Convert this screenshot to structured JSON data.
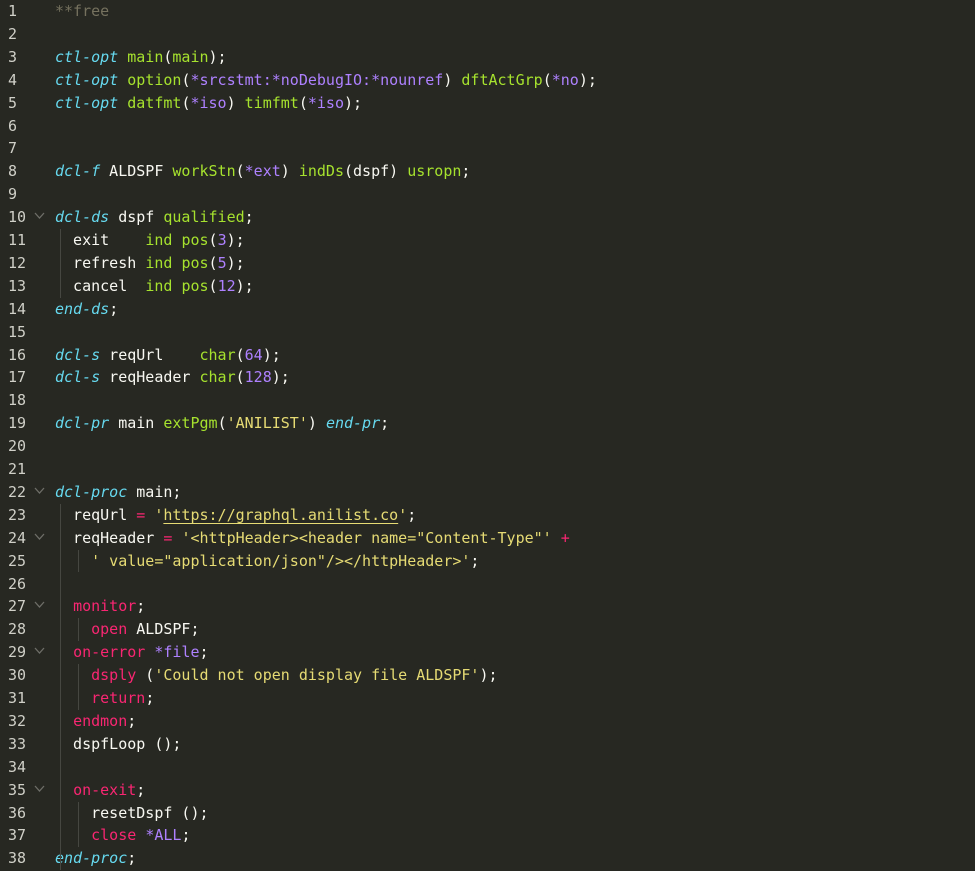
{
  "editor": {
    "lines": [
      {
        "n": "1",
        "fold": false,
        "tokens": [
          {
            "c": "c",
            "t": "**free"
          }
        ]
      },
      {
        "n": "2",
        "fold": false,
        "tokens": []
      },
      {
        "n": "3",
        "fold": false,
        "tokens": [
          {
            "c": "k",
            "t": "ctl-opt"
          },
          {
            "c": "t",
            "t": " "
          },
          {
            "c": "f",
            "t": "main"
          },
          {
            "c": "t",
            "t": "("
          },
          {
            "c": "f",
            "t": "main"
          },
          {
            "c": "t",
            "t": ");"
          }
        ]
      },
      {
        "n": "4",
        "fold": false,
        "tokens": [
          {
            "c": "k",
            "t": "ctl-opt"
          },
          {
            "c": "t",
            "t": " "
          },
          {
            "c": "f",
            "t": "option"
          },
          {
            "c": "t",
            "t": "("
          },
          {
            "c": "a",
            "t": "*srcstmt:*noDebugIO:*nounref"
          },
          {
            "c": "t",
            "t": ") "
          },
          {
            "c": "f",
            "t": "dftActGrp"
          },
          {
            "c": "t",
            "t": "("
          },
          {
            "c": "a",
            "t": "*no"
          },
          {
            "c": "t",
            "t": ");"
          }
        ]
      },
      {
        "n": "5",
        "fold": false,
        "tokens": [
          {
            "c": "k",
            "t": "ctl-opt"
          },
          {
            "c": "t",
            "t": " "
          },
          {
            "c": "f",
            "t": "datfmt"
          },
          {
            "c": "t",
            "t": "("
          },
          {
            "c": "a",
            "t": "*iso"
          },
          {
            "c": "t",
            "t": ") "
          },
          {
            "c": "f",
            "t": "timfmt"
          },
          {
            "c": "t",
            "t": "("
          },
          {
            "c": "a",
            "t": "*iso"
          },
          {
            "c": "t",
            "t": ");"
          }
        ]
      },
      {
        "n": "6",
        "fold": false,
        "tokens": []
      },
      {
        "n": "7",
        "fold": false,
        "tokens": []
      },
      {
        "n": "8",
        "fold": false,
        "tokens": [
          {
            "c": "k",
            "t": "dcl-f"
          },
          {
            "c": "t",
            "t": " ALDSPF "
          },
          {
            "c": "f",
            "t": "workStn"
          },
          {
            "c": "t",
            "t": "("
          },
          {
            "c": "a",
            "t": "*ext"
          },
          {
            "c": "t",
            "t": ") "
          },
          {
            "c": "f",
            "t": "indDs"
          },
          {
            "c": "t",
            "t": "(dspf) "
          },
          {
            "c": "f",
            "t": "usropn"
          },
          {
            "c": "t",
            "t": ";"
          }
        ]
      },
      {
        "n": "9",
        "fold": false,
        "tokens": []
      },
      {
        "n": "10",
        "fold": true,
        "tokens": [
          {
            "c": "k",
            "t": "dcl-ds"
          },
          {
            "c": "t",
            "t": " dspf "
          },
          {
            "c": "f",
            "t": "qualified"
          },
          {
            "c": "t",
            "t": ";"
          }
        ]
      },
      {
        "n": "11",
        "fold": false,
        "tokens": [
          {
            "c": "t",
            "t": "  exit    "
          },
          {
            "c": "f",
            "t": "ind"
          },
          {
            "c": "t",
            "t": " "
          },
          {
            "c": "f",
            "t": "pos"
          },
          {
            "c": "t",
            "t": "("
          },
          {
            "c": "a",
            "t": "3"
          },
          {
            "c": "t",
            "t": ");"
          }
        ]
      },
      {
        "n": "12",
        "fold": false,
        "tokens": [
          {
            "c": "t",
            "t": "  refresh "
          },
          {
            "c": "f",
            "t": "ind"
          },
          {
            "c": "t",
            "t": " "
          },
          {
            "c": "f",
            "t": "pos"
          },
          {
            "c": "t",
            "t": "("
          },
          {
            "c": "a",
            "t": "5"
          },
          {
            "c": "t",
            "t": ");"
          }
        ]
      },
      {
        "n": "13",
        "fold": false,
        "tokens": [
          {
            "c": "t",
            "t": "  cancel  "
          },
          {
            "c": "f",
            "t": "ind"
          },
          {
            "c": "t",
            "t": " "
          },
          {
            "c": "f",
            "t": "pos"
          },
          {
            "c": "t",
            "t": "("
          },
          {
            "c": "a",
            "t": "12"
          },
          {
            "c": "t",
            "t": ");"
          }
        ]
      },
      {
        "n": "14",
        "fold": false,
        "tokens": [
          {
            "c": "k",
            "t": "end-ds"
          },
          {
            "c": "t",
            "t": ";"
          }
        ]
      },
      {
        "n": "15",
        "fold": false,
        "tokens": []
      },
      {
        "n": "16",
        "fold": false,
        "tokens": [
          {
            "c": "k",
            "t": "dcl-s"
          },
          {
            "c": "t",
            "t": " reqUrl    "
          },
          {
            "c": "f",
            "t": "char"
          },
          {
            "c": "t",
            "t": "("
          },
          {
            "c": "a",
            "t": "64"
          },
          {
            "c": "t",
            "t": ");"
          }
        ]
      },
      {
        "n": "17",
        "fold": false,
        "tokens": [
          {
            "c": "k",
            "t": "dcl-s"
          },
          {
            "c": "t",
            "t": " reqHeader "
          },
          {
            "c": "f",
            "t": "char"
          },
          {
            "c": "t",
            "t": "("
          },
          {
            "c": "a",
            "t": "128"
          },
          {
            "c": "t",
            "t": ");"
          }
        ]
      },
      {
        "n": "18",
        "fold": false,
        "tokens": []
      },
      {
        "n": "19",
        "fold": false,
        "tokens": [
          {
            "c": "k",
            "t": "dcl-pr"
          },
          {
            "c": "t",
            "t": " main "
          },
          {
            "c": "f",
            "t": "extPgm"
          },
          {
            "c": "t",
            "t": "("
          },
          {
            "c": "s",
            "t": "'ANILIST'"
          },
          {
            "c": "t",
            "t": ") "
          },
          {
            "c": "k",
            "t": "end-pr"
          },
          {
            "c": "t",
            "t": ";"
          }
        ]
      },
      {
        "n": "20",
        "fold": false,
        "tokens": []
      },
      {
        "n": "21",
        "fold": false,
        "tokens": []
      },
      {
        "n": "22",
        "fold": true,
        "tokens": [
          {
            "c": "k",
            "t": "dcl-proc"
          },
          {
            "c": "t",
            "t": " main;"
          }
        ]
      },
      {
        "n": "23",
        "fold": false,
        "tokens": [
          {
            "c": "t",
            "t": "  reqUrl "
          },
          {
            "c": "p",
            "t": "="
          },
          {
            "c": "t",
            "t": " "
          },
          {
            "c": "s",
            "t": "'"
          },
          {
            "c": "su",
            "t": "https://graphql.anilist.co"
          },
          {
            "c": "s",
            "t": "'"
          },
          {
            "c": "t",
            "t": ";"
          }
        ]
      },
      {
        "n": "24",
        "fold": true,
        "tokens": [
          {
            "c": "t",
            "t": "  reqHeader "
          },
          {
            "c": "p",
            "t": "="
          },
          {
            "c": "t",
            "t": " "
          },
          {
            "c": "s",
            "t": "'<httpHeader><header name=\"Content-Type\"'"
          },
          {
            "c": "t",
            "t": " "
          },
          {
            "c": "p",
            "t": "+"
          }
        ]
      },
      {
        "n": "25",
        "fold": false,
        "tokens": [
          {
            "c": "t",
            "t": "    "
          },
          {
            "c": "s",
            "t": "' value=\"application/json\"/></httpHeader>'"
          },
          {
            "c": "t",
            "t": ";"
          }
        ]
      },
      {
        "n": "26",
        "fold": false,
        "tokens": []
      },
      {
        "n": "27",
        "fold": true,
        "tokens": [
          {
            "c": "t",
            "t": "  "
          },
          {
            "c": "p",
            "t": "monitor"
          },
          {
            "c": "t",
            "t": ";"
          }
        ]
      },
      {
        "n": "28",
        "fold": false,
        "tokens": [
          {
            "c": "t",
            "t": "    "
          },
          {
            "c": "p",
            "t": "open"
          },
          {
            "c": "t",
            "t": " ALDSPF;"
          }
        ]
      },
      {
        "n": "29",
        "fold": true,
        "tokens": [
          {
            "c": "t",
            "t": "  "
          },
          {
            "c": "p",
            "t": "on-error"
          },
          {
            "c": "t",
            "t": " "
          },
          {
            "c": "a",
            "t": "*file"
          },
          {
            "c": "t",
            "t": ";"
          }
        ]
      },
      {
        "n": "30",
        "fold": false,
        "tokens": [
          {
            "c": "t",
            "t": "    "
          },
          {
            "c": "p",
            "t": "dsply"
          },
          {
            "c": "t",
            "t": " ("
          },
          {
            "c": "s",
            "t": "'Could not open display file ALDSPF'"
          },
          {
            "c": "t",
            "t": ");"
          }
        ]
      },
      {
        "n": "31",
        "fold": false,
        "tokens": [
          {
            "c": "t",
            "t": "    "
          },
          {
            "c": "p",
            "t": "return"
          },
          {
            "c": "t",
            "t": ";"
          }
        ]
      },
      {
        "n": "32",
        "fold": false,
        "tokens": [
          {
            "c": "t",
            "t": "  "
          },
          {
            "c": "p",
            "t": "endmon"
          },
          {
            "c": "t",
            "t": ";"
          }
        ]
      },
      {
        "n": "33",
        "fold": false,
        "tokens": [
          {
            "c": "t",
            "t": "  dspfLoop ();"
          }
        ]
      },
      {
        "n": "34",
        "fold": false,
        "tokens": []
      },
      {
        "n": "35",
        "fold": true,
        "tokens": [
          {
            "c": "t",
            "t": "  "
          },
          {
            "c": "p",
            "t": "on-exit"
          },
          {
            "c": "t",
            "t": ";"
          }
        ]
      },
      {
        "n": "36",
        "fold": false,
        "tokens": [
          {
            "c": "t",
            "t": "    resetDspf ();"
          }
        ]
      },
      {
        "n": "37",
        "fold": false,
        "tokens": [
          {
            "c": "t",
            "t": "    "
          },
          {
            "c": "p",
            "t": "close"
          },
          {
            "c": "t",
            "t": " "
          },
          {
            "c": "a",
            "t": "*ALL"
          },
          {
            "c": "t",
            "t": ";"
          }
        ]
      },
      {
        "n": "38",
        "fold": false,
        "tokens": [
          {
            "c": "k",
            "t": "end-proc"
          },
          {
            "c": "t",
            "t": ";"
          }
        ]
      }
    ]
  }
}
